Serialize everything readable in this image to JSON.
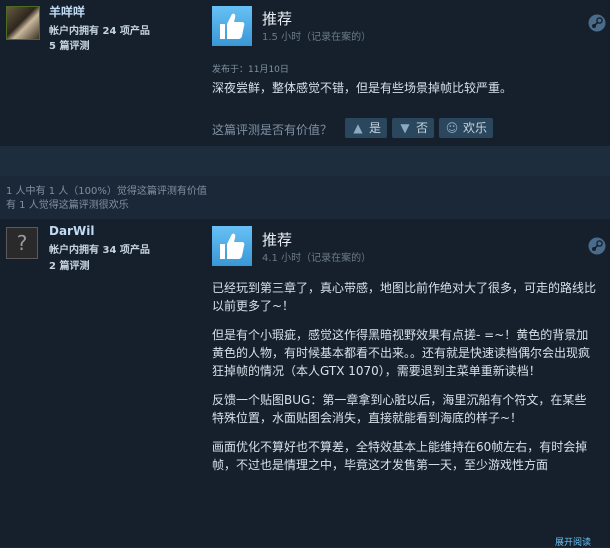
{
  "review1": {
    "user_name": "羊咩咩",
    "products_owned": "帐户内拥有 24 项产品",
    "review_count": "5 篇评测",
    "verdict": "推荐",
    "hours": "1.5 小时（记录在案的）",
    "posted": "发布于：11月10日",
    "body": "深夜尝鲜，整体感觉不错，但是有些场景掉帧比较严重。",
    "helpful_question": "这篇评测是否有价值？",
    "btn_yes": "是",
    "btn_no": "否",
    "btn_funny": "欢乐"
  },
  "stats": {
    "helpful_line": "1 人中有 1 人（100%）觉得这篇评测有价值",
    "funny_line": "有 1 人觉得这篇评测很欢乐"
  },
  "review2": {
    "user_name": "DarWil",
    "products_owned": "帐户内拥有 34 项产品",
    "review_count": "2 篇评测",
    "verdict": "推荐",
    "hours": "4.1 小时（记录在案的）",
    "paragraphs": [
      "已经玩到第三章了，真心带感，地图比前作绝对大了很多，可走的路线比以前更多了~！",
      "但是有个小瑕疵，感觉这作得黑暗视野效果有点搓- =~！黄色的背景加黄色的人物，有时候基本都看不出来。。还有就是快速读档偶尔会出现疯狂掉帧的情况（本人GTX 1070），需要退到主菜单重新读档！",
      "反馈一个贴图BUG：第一章拿到心脏以后，海里沉船有个符文，在某些特殊位置，水面贴图会消失，直接就能看到海底的样子~！",
      "画面优化不算好也不算差，全特效基本上能维持在60帧左右，有时会掉帧，不过也是情理之中，毕竟这才发售第一天，至少游戏性方面"
    ],
    "expand": "展开阅读"
  },
  "icons": {
    "thumb": "thumbs-up-icon",
    "steam": "steam-logo-icon",
    "yes": "thumbs-up-small-icon",
    "no": "thumbs-down-small-icon",
    "funny": "smiley-icon"
  },
  "colors": {
    "accent": "#67c1f5",
    "background": "#1b2838",
    "review_bg": "#16202d"
  }
}
